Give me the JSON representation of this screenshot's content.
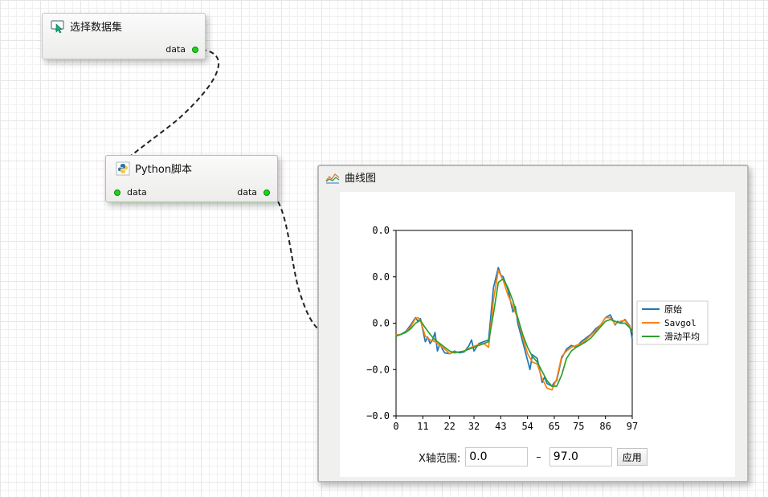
{
  "nodes": {
    "dataset": {
      "title": "选择数据集",
      "output_port": "data"
    },
    "python": {
      "title": "Python脚本",
      "input_port": "data",
      "output_port": "data"
    },
    "curve": {
      "title": "曲线图"
    }
  },
  "range": {
    "label": "X轴范围:",
    "min_value": "0.0",
    "separator": "–",
    "max_value": "97.0",
    "apply_label": "应用"
  },
  "colors": {
    "original": "#1f77b4",
    "savgol": "#ff7f0e",
    "moving_avg": "#2ca02c",
    "port": "#19d619",
    "selected_border": "#7fe27f"
  },
  "chart_data": {
    "type": "line",
    "title": "",
    "xlabel": "",
    "ylabel": "",
    "xlim": [
      0,
      97
    ],
    "ylim": [
      -1,
      1
    ],
    "x_ticks": [
      "0",
      "11",
      "22",
      "32",
      "43",
      "54",
      "65",
      "75",
      "86",
      "97"
    ],
    "y_ticks": [
      "0.0",
      "0.0",
      "0.0",
      "−0.0",
      "−0.0"
    ],
    "legend_position": "right-outside",
    "series": [
      {
        "name": "原始",
        "color": "#1f77b4",
        "x": [
          0,
          2,
          4,
          6,
          8,
          9,
          10,
          12,
          13,
          14,
          15,
          16,
          17,
          18,
          19,
          20,
          22,
          24,
          26,
          28,
          30,
          31,
          32,
          34,
          36,
          38,
          40,
          42,
          43,
          44,
          46,
          48,
          49,
          50,
          52,
          54,
          55,
          56,
          58,
          60,
          61,
          62,
          64,
          65,
          66,
          68,
          70,
          72,
          74,
          76,
          78,
          80,
          82,
          84,
          86,
          88,
          90,
          91,
          92,
          94,
          96,
          97
        ],
        "y": [
          -0.13,
          -0.12,
          -0.09,
          -0.02,
          0.06,
          0.02,
          0.05,
          -0.2,
          -0.15,
          -0.22,
          -0.18,
          -0.1,
          -0.3,
          -0.22,
          -0.28,
          -0.32,
          -0.33,
          -0.3,
          -0.32,
          -0.31,
          -0.24,
          -0.18,
          -0.3,
          -0.22,
          -0.2,
          -0.18,
          0.38,
          0.6,
          0.52,
          0.5,
          0.36,
          0.12,
          0.18,
          0.0,
          -0.2,
          -0.4,
          -0.5,
          -0.34,
          -0.38,
          -0.64,
          -0.58,
          -0.65,
          -0.68,
          -0.64,
          -0.62,
          -0.38,
          -0.28,
          -0.24,
          -0.26,
          -0.2,
          -0.16,
          -0.12,
          -0.06,
          -0.02,
          0.06,
          0.09,
          -0.02,
          0.02,
          0.0,
          0.04,
          -0.03,
          -0.17
        ]
      },
      {
        "name": "Savgol",
        "color": "#ff7f0e",
        "x": [
          0,
          2,
          4,
          6,
          8,
          9,
          10,
          12,
          14,
          16,
          18,
          20,
          22,
          24,
          26,
          28,
          30,
          32,
          34,
          36,
          38,
          40,
          42,
          44,
          46,
          48,
          50,
          52,
          54,
          56,
          58,
          60,
          62,
          64,
          66,
          68,
          70,
          72,
          74,
          76,
          78,
          80,
          82,
          84,
          86,
          88,
          90,
          92,
          94,
          96,
          97
        ],
        "y": [
          -0.13,
          -0.12,
          -0.1,
          -0.04,
          0.05,
          0.06,
          0.03,
          -0.14,
          -0.18,
          -0.2,
          -0.24,
          -0.28,
          -0.33,
          -0.31,
          -0.31,
          -0.3,
          -0.27,
          -0.25,
          -0.23,
          -0.22,
          -0.26,
          0.25,
          0.57,
          0.46,
          0.3,
          0.18,
          0.05,
          -0.15,
          -0.33,
          -0.42,
          -0.44,
          -0.6,
          -0.7,
          -0.72,
          -0.6,
          -0.36,
          -0.3,
          -0.26,
          -0.24,
          -0.22,
          -0.18,
          -0.13,
          -0.08,
          -0.02,
          0.06,
          0.06,
          -0.01,
          0.02,
          0.03,
          -0.04,
          -0.1
        ]
      },
      {
        "name": "滑动平均",
        "color": "#2ca02c",
        "x": [
          0,
          2,
          4,
          6,
          8,
          10,
          12,
          14,
          16,
          18,
          20,
          22,
          24,
          26,
          28,
          30,
          32,
          34,
          36,
          38,
          40,
          42,
          44,
          46,
          48,
          50,
          52,
          54,
          56,
          58,
          60,
          62,
          64,
          66,
          68,
          70,
          72,
          74,
          76,
          78,
          80,
          82,
          84,
          86,
          88,
          90,
          92,
          94,
          96,
          97
        ],
        "y": [
          -0.14,
          -0.12,
          -0.1,
          -0.06,
          0.0,
          0.03,
          -0.05,
          -0.12,
          -0.18,
          -0.22,
          -0.26,
          -0.3,
          -0.32,
          -0.31,
          -0.3,
          -0.28,
          -0.26,
          -0.24,
          -0.22,
          -0.2,
          0.1,
          0.44,
          0.48,
          0.38,
          0.24,
          0.06,
          -0.12,
          -0.26,
          -0.36,
          -0.42,
          -0.52,
          -0.62,
          -0.68,
          -0.68,
          -0.56,
          -0.38,
          -0.3,
          -0.26,
          -0.23,
          -0.2,
          -0.16,
          -0.1,
          -0.04,
          0.02,
          0.04,
          0.02,
          0.0,
          0.0,
          -0.05,
          -0.1
        ]
      }
    ]
  }
}
